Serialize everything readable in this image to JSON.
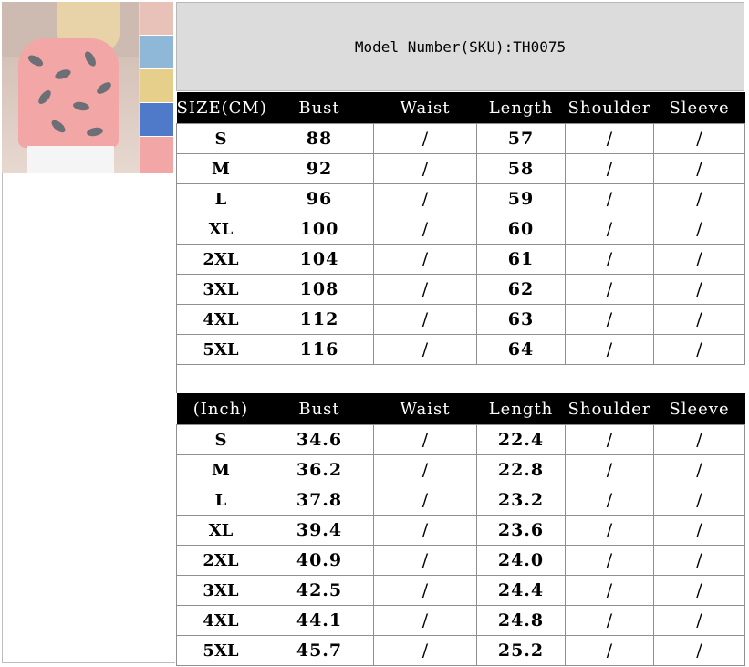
{
  "header": {
    "model_text": "Model Number(SKU):TH0075"
  },
  "photo": {
    "colors": [
      "#f2a7a6",
      "#8fb7d8",
      "#e6cf8a",
      "#4f79c9",
      "#e8c2b8"
    ]
  },
  "cm_table": {
    "headers": [
      "SIZE(CM)",
      "Bust",
      "Waist",
      "Length",
      "Shoulder",
      "Sleeve"
    ],
    "rows": [
      [
        "S",
        "88",
        "/",
        "57",
        "/",
        "/"
      ],
      [
        "M",
        "92",
        "/",
        "58",
        "/",
        "/"
      ],
      [
        "L",
        "96",
        "/",
        "59",
        "/",
        "/"
      ],
      [
        "XL",
        "100",
        "/",
        "60",
        "/",
        "/"
      ],
      [
        "2XL",
        "104",
        "/",
        "61",
        "/",
        "/"
      ],
      [
        "3XL",
        "108",
        "/",
        "62",
        "/",
        "/"
      ],
      [
        "4XL",
        "112",
        "/",
        "63",
        "/",
        "/"
      ],
      [
        "5XL",
        "116",
        "/",
        "64",
        "/",
        "/"
      ]
    ]
  },
  "inch_table": {
    "headers": [
      "(Inch)",
      "Bust",
      "Waist",
      "Length",
      "Shoulder",
      "Sleeve"
    ],
    "rows": [
      [
        "S",
        "34.6",
        "/",
        "22.4",
        "/",
        "/"
      ],
      [
        "M",
        "36.2",
        "/",
        "22.8",
        "/",
        "/"
      ],
      [
        "L",
        "37.8",
        "/",
        "23.2",
        "/",
        "/"
      ],
      [
        "XL",
        "39.4",
        "/",
        "23.6",
        "/",
        "/"
      ],
      [
        "2XL",
        "40.9",
        "/",
        "24.0",
        "/",
        "/"
      ],
      [
        "3XL",
        "42.5",
        "/",
        "24.4",
        "/",
        "/"
      ],
      [
        "4XL",
        "44.1",
        "/",
        "24.8",
        "/",
        "/"
      ],
      [
        "5XL",
        "45.7",
        "/",
        "25.2",
        "/",
        "/"
      ]
    ]
  }
}
